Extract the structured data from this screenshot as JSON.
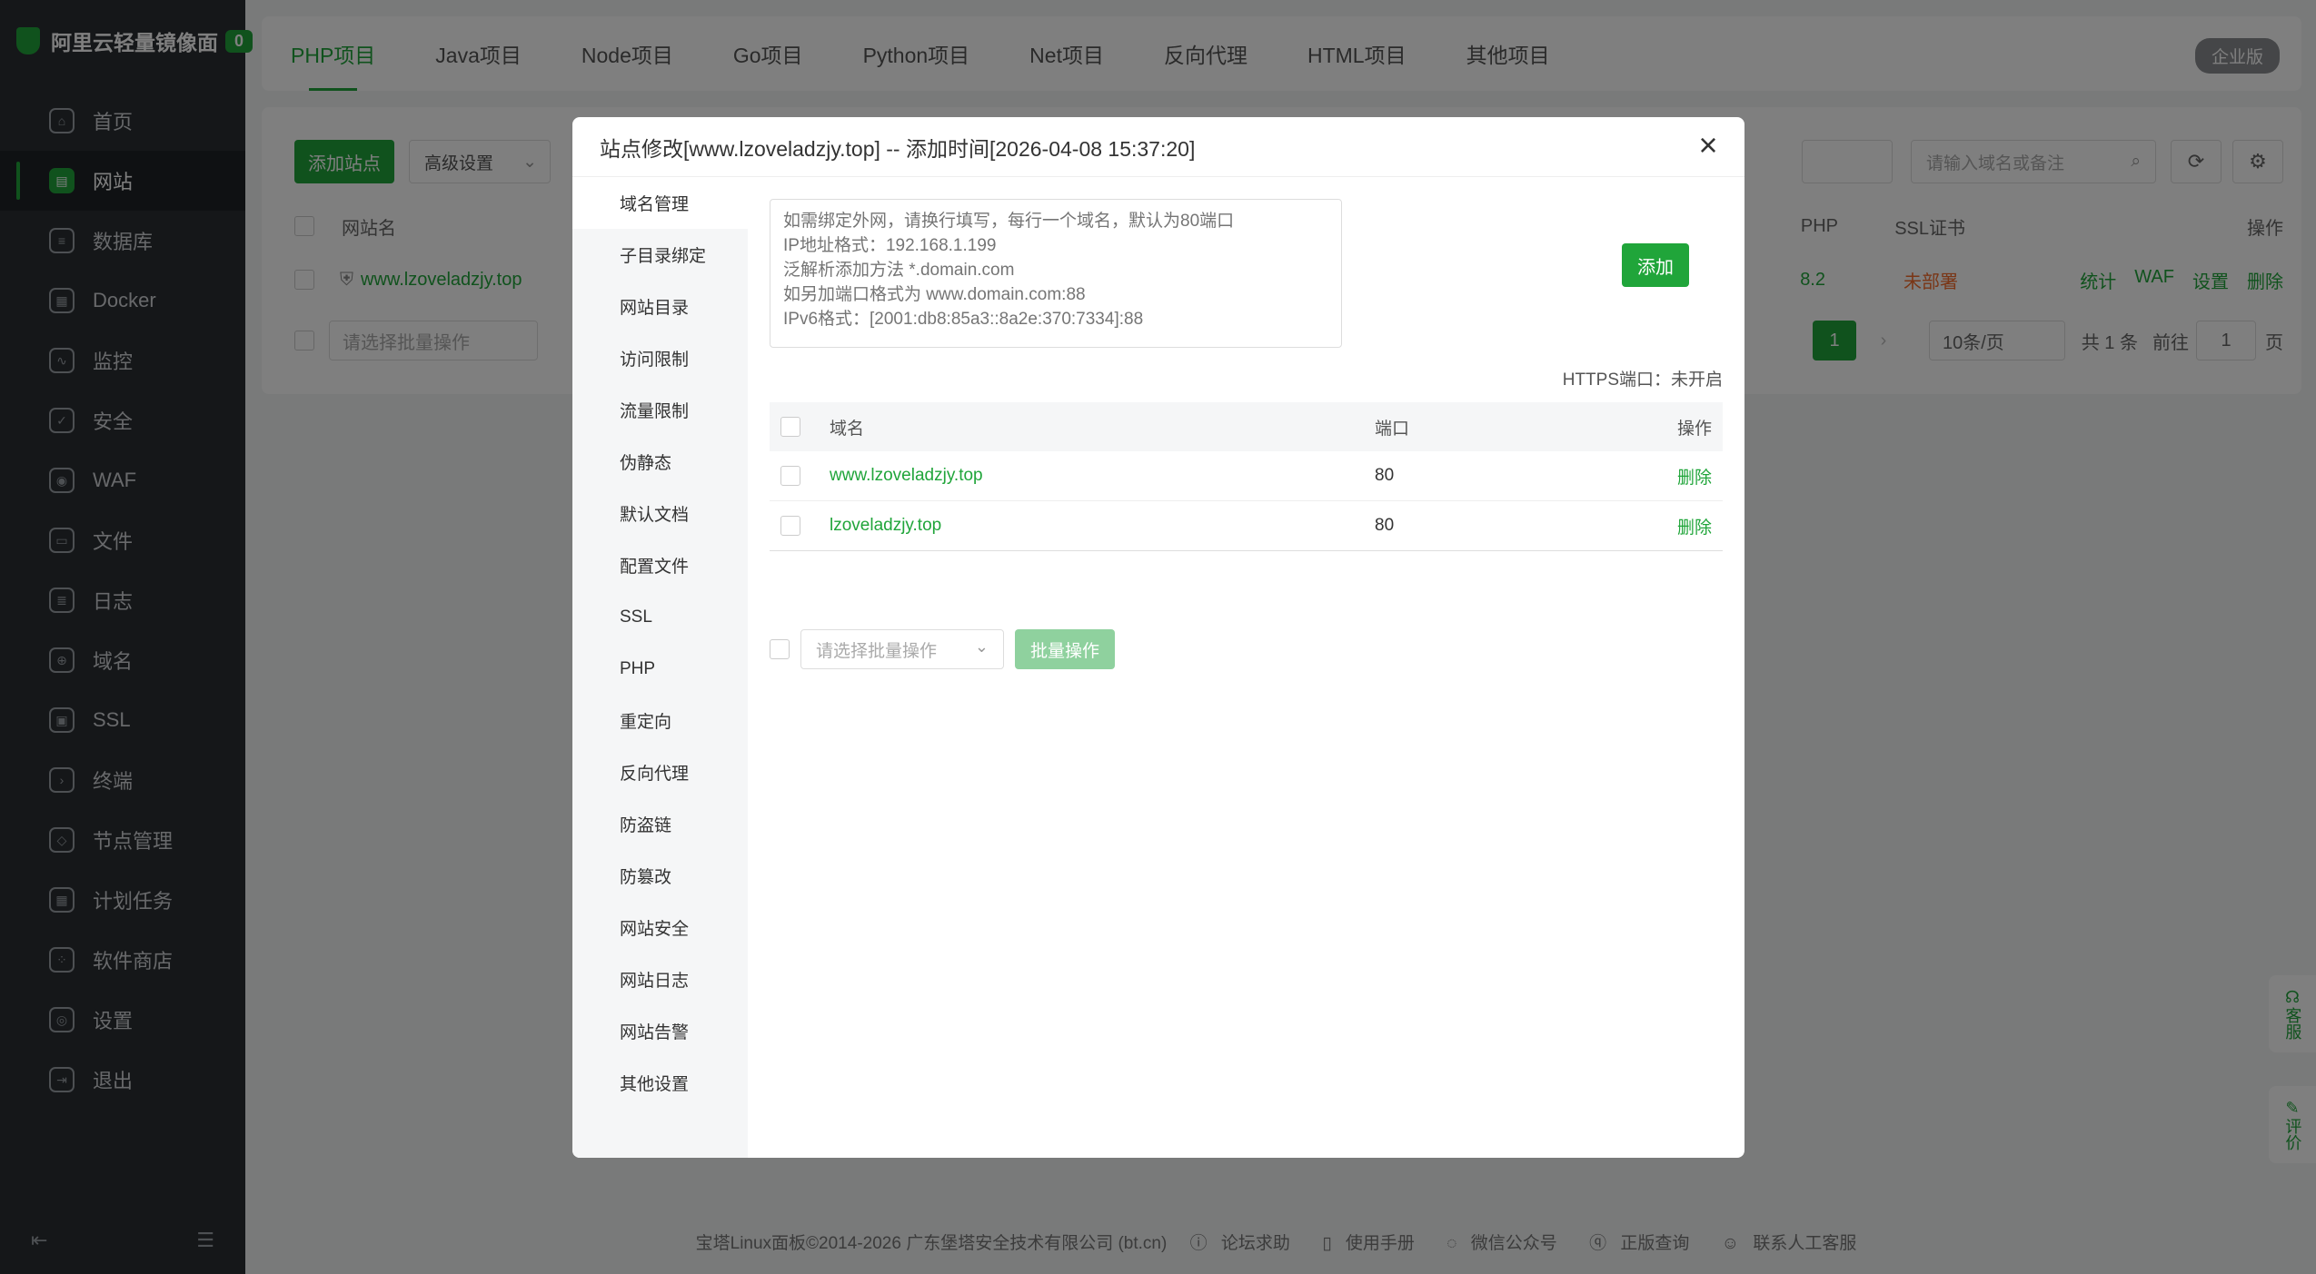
{
  "brand": {
    "name": "阿里云轻量镜像面",
    "badge": "0"
  },
  "sidebar": {
    "items": [
      {
        "label": "首页",
        "icon": "home-icon",
        "glyph": "⌂"
      },
      {
        "label": "网站",
        "icon": "globe-icon",
        "glyph": "▤"
      },
      {
        "label": "数据库",
        "icon": "database-icon",
        "glyph": "≡"
      },
      {
        "label": "Docker",
        "icon": "docker-icon",
        "glyph": "▦"
      },
      {
        "label": "监控",
        "icon": "monitor-icon",
        "glyph": "∿"
      },
      {
        "label": "安全",
        "icon": "shield-icon",
        "glyph": "✓"
      },
      {
        "label": "WAF",
        "icon": "waf-icon",
        "glyph": "◉"
      },
      {
        "label": "文件",
        "icon": "folder-icon",
        "glyph": "▭"
      },
      {
        "label": "日志",
        "icon": "log-icon",
        "glyph": "≣"
      },
      {
        "label": "域名",
        "icon": "domain-icon",
        "glyph": "⊕"
      },
      {
        "label": "SSL",
        "icon": "ssl-icon",
        "glyph": "▣"
      },
      {
        "label": "终端",
        "icon": "terminal-icon",
        "glyph": "›"
      },
      {
        "label": "节点管理",
        "icon": "node-icon",
        "glyph": "◇"
      },
      {
        "label": "计划任务",
        "icon": "calendar-icon",
        "glyph": "▦"
      },
      {
        "label": "软件商店",
        "icon": "store-icon",
        "glyph": "⁘"
      },
      {
        "label": "设置",
        "icon": "settings-icon",
        "glyph": "◎"
      },
      {
        "label": "退出",
        "icon": "logout-icon",
        "glyph": "⇥"
      }
    ],
    "active_index": 1,
    "collapse_glyph": "⇤",
    "menu_glyph": "☰"
  },
  "top_tabs": [
    "PHP项目",
    "Java项目",
    "Node项目",
    "Go项目",
    "Python项目",
    "Net项目",
    "反向代理",
    "HTML项目",
    "其他项目"
  ],
  "enterprise_label": "企业版",
  "background_page": {
    "add_site": "添加站点",
    "advanced": "高级设置",
    "search_placeholder": "请输入域名或备注",
    "col_site": "网站名",
    "col_php": "PHP",
    "col_ssl": "SSL证书",
    "col_ops": "操作",
    "row": {
      "site": "www.lzoveladzjy.top",
      "php": "8.2",
      "ssl": "未部署",
      "ops": [
        "统计",
        "WAF",
        "设置",
        "删除"
      ]
    },
    "batch_placeholder": "请选择批量操作",
    "pagination": {
      "current": "1",
      "per_page": "10条/页",
      "total": "共 1 条",
      "goto": "前往",
      "goto_value": "1",
      "page_unit": "页"
    }
  },
  "modal": {
    "title": "站点修改[www.lzoveladzjy.top] -- 添加时间[2026-04-08 15:37:20]",
    "close": "×",
    "menu": [
      "域名管理",
      "子目录绑定",
      "网站目录",
      "访问限制",
      "流量限制",
      "伪静态",
      "默认文档",
      "配置文件",
      "SSL",
      "PHP",
      "重定向",
      "反向代理",
      "防盗链",
      "防篡改",
      "网站安全",
      "网站日志",
      "网站告警",
      "其他设置"
    ],
    "active_menu": 0,
    "domain_placeholder": "如需绑定外网，请换行填写，每行一个域名，默认为80端口\nIP地址格式：192.168.1.199\n泛解析添加方法 *.domain.com\n如另加端口格式为 www.domain.com:88\nIPv6格式：[2001:db8:85a3::8a2e:370:7334]:88",
    "add_button": "添加",
    "https_port": "HTTPS端口：未开启",
    "table_headers": {
      "domain": "域名",
      "port": "端口",
      "ops": "操作"
    },
    "rows": [
      {
        "domain": "www.lzoveladzjy.top",
        "port": "80",
        "op": "删除"
      },
      {
        "domain": "lzoveladzjy.top",
        "port": "80",
        "op": "删除"
      }
    ],
    "batch_placeholder": "请选择批量操作",
    "batch_button": "批量操作"
  },
  "footer": {
    "copyright": "宝塔Linux面板©2014-2026 广东堡塔安全技术有限公司 (bt.cn)",
    "links": [
      "论坛求助",
      "使用手册",
      "微信公众号",
      "正版查询",
      "联系人工客服"
    ]
  },
  "float": {
    "service": "客服",
    "rate": "评价"
  },
  "colors": {
    "accent": "#20a53a",
    "sidebar": "#2b2f33",
    "warning": "#f56c2c"
  }
}
